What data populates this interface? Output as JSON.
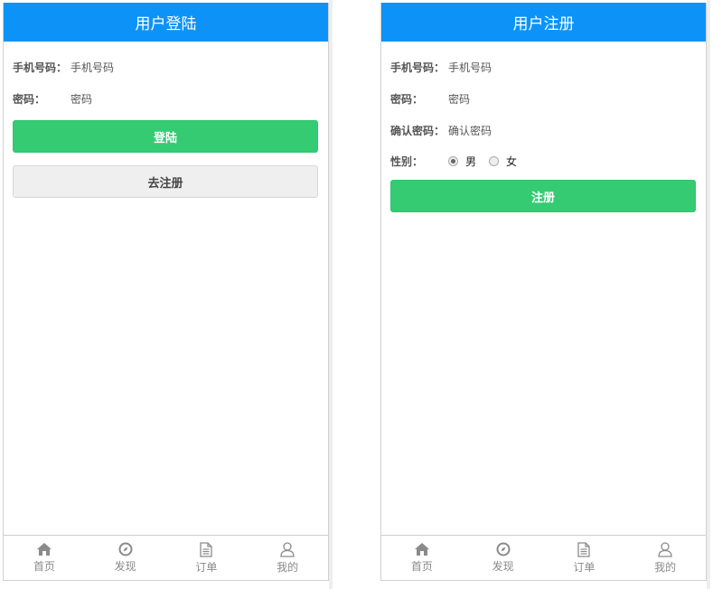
{
  "login": {
    "title": "用户登陆",
    "phone_label": "手机号码：",
    "phone_placeholder": "手机号码",
    "password_label": "密码：",
    "password_placeholder": "密码",
    "submit_label": "登陆",
    "register_label": "去注册"
  },
  "register": {
    "title": "用户注册",
    "phone_label": "手机号码：",
    "phone_placeholder": "手机号码",
    "password_label": "密码：",
    "password_placeholder": "密码",
    "confirm_label": "确认密码：",
    "confirm_placeholder": "确认密码",
    "gender_label": "性别：",
    "gender_options": [
      "男",
      "女"
    ],
    "gender_selected": "男",
    "submit_label": "注册"
  },
  "tabbar": {
    "items": [
      {
        "label": "首页",
        "icon": "home-icon"
      },
      {
        "label": "发现",
        "icon": "compass-icon"
      },
      {
        "label": "订单",
        "icon": "document-icon"
      },
      {
        "label": "我的",
        "icon": "user-icon"
      }
    ]
  },
  "colors": {
    "header": "#0d93f7",
    "primary_button": "#35cb73",
    "secondary_button": "#efefef",
    "tab_text": "#8a8a8a"
  }
}
